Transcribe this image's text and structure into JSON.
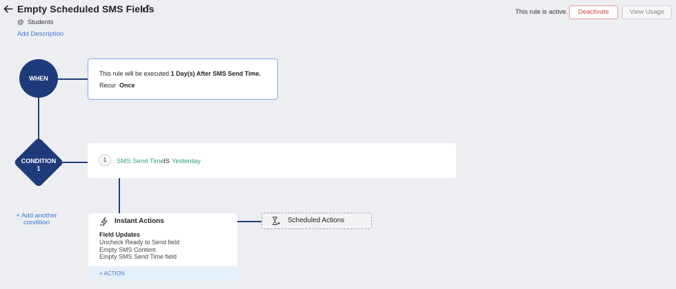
{
  "header": {
    "title": "Empty Scheduled SMS Fields",
    "module_prefix": "@",
    "module": "Students",
    "add_description": "Add Description",
    "active_text": "This rule is active.",
    "deactivate_label": "Deactivate",
    "view_usage_label": "View Usage"
  },
  "when": {
    "node_label": "WHEN",
    "line1_prefix": "This rule will be executed ",
    "line1_bold": "1 Day(s) After SMS Send Time.",
    "recur_label": "Recur",
    "recur_value": "Once"
  },
  "condition": {
    "node_label_line1": "CONDITION",
    "node_label_line2": "1",
    "number": "1",
    "field": "SMS Send Time",
    "operator": "IS",
    "value": "Yesterday",
    "add_another": "+ Add another condition"
  },
  "instant_actions": {
    "title": "Instant Actions",
    "field_updates_title": "Field Updates",
    "items": [
      "Uncheck Ready to Send field",
      "Empty SMS Content",
      "Empty SMS Send Time field"
    ],
    "action_button": "+ ACTION"
  },
  "scheduled_actions": {
    "label": "Scheduled Actions"
  },
  "colors": {
    "node": "#1f3a7a",
    "link": "#3c7bd6",
    "criteria_green": "#2f9e7e",
    "danger": "#d24848"
  }
}
